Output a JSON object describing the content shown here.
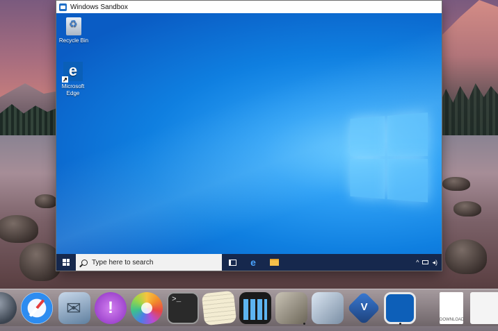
{
  "window": {
    "title": "Windows Sandbox"
  },
  "desktop": {
    "icons": [
      {
        "label": "Recycle Bin"
      },
      {
        "label": "Microsoft Edge"
      }
    ]
  },
  "taskbar": {
    "search_placeholder": "Type here to search"
  },
  "dock": {
    "items": [
      {
        "icon": "launchpad-icon"
      },
      {
        "icon": "safari-icon"
      },
      {
        "icon": "mail-icon"
      },
      {
        "icon": "podcasts-icon"
      },
      {
        "icon": "photos-icon"
      },
      {
        "icon": "terminal-icon"
      },
      {
        "icon": "notes-icon"
      },
      {
        "icon": "activity-monitor-icon"
      },
      {
        "icon": "script-editor-icon"
      },
      {
        "icon": "preview-icon"
      },
      {
        "icon": "virtualbox-icon"
      },
      {
        "icon": "windows-sandbox-icon"
      },
      {
        "icon": "download-document-icon",
        "label": "DOWNLOAD"
      },
      {
        "icon": "finder-window-icon"
      }
    ]
  }
}
